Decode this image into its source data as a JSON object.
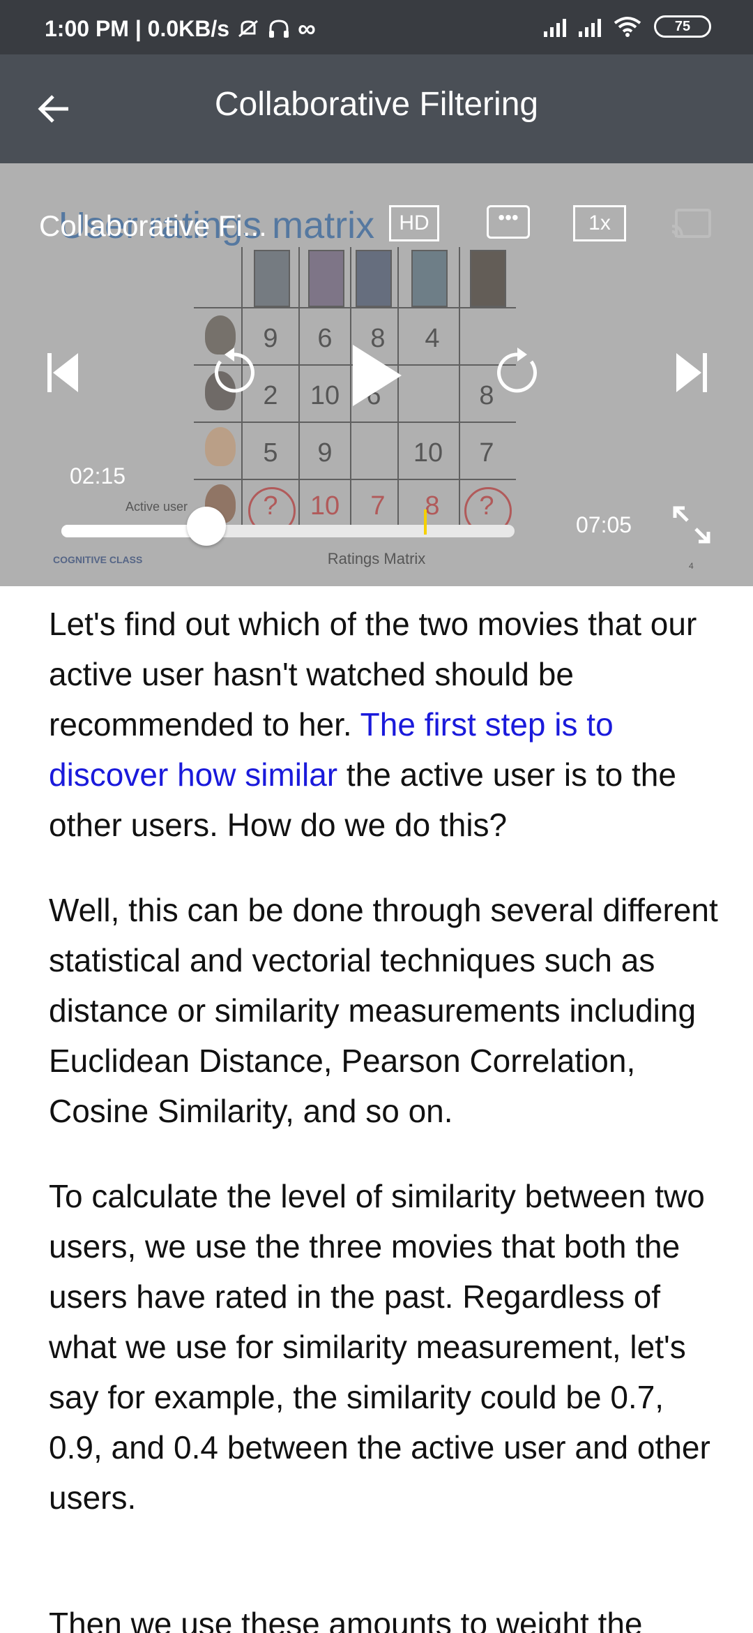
{
  "status_bar": {
    "left": "1:00 PM | 0.0KB/s",
    "battery": "75"
  },
  "app_bar": {
    "title": "Collaborative Filtering"
  },
  "video": {
    "title": "Collaborative Fi...",
    "slide_title": "User ratings matrix",
    "hd_label": "HD",
    "speed_label": "1x",
    "current_time": "02:15",
    "total_time": "07:05",
    "progress": 0.32,
    "slide_caption": "Ratings Matrix",
    "active_user_label": "Active user",
    "logo_text": "COGNITIVE CLASS",
    "slide_page": "4",
    "matrix": {
      "rows": [
        [
          "9",
          "6",
          "8",
          "4",
          ""
        ],
        [
          "2",
          "10",
          "6",
          "",
          "8"
        ],
        [
          "5",
          "9",
          "",
          "10",
          "7"
        ],
        [
          "?",
          "10",
          "7",
          "8",
          "?"
        ]
      ]
    }
  },
  "article": {
    "p1_before": "Let's find out which of the two movies that our active user hasn't watched should be recommended to her. ",
    "p1_link": "The first step is to discover how similar",
    "p1_after": " the active user is to the other users.  How do we do this?",
    "p2": "Well, this can be done through several different statistical and vectorial techniques such as distance or similarity measurements including Euclidean Distance, Pearson Correlation, Cosine Similarity, and so on.",
    "p3": "To calculate the level of similarity between two users, we use the three movies that both the users have rated in the past. Regardless of what we use for similarity measurement, let's say for example, the similarity could be 0.7, 0.9, and 0.4 between the active user and other users.",
    "p4_partial": "Then we use these amounts to weight the"
  },
  "colors": {
    "status_bar": "#393c41",
    "app_bar": "#4a4f56",
    "link": "#1a1adb",
    "marker": "#f5d000"
  }
}
